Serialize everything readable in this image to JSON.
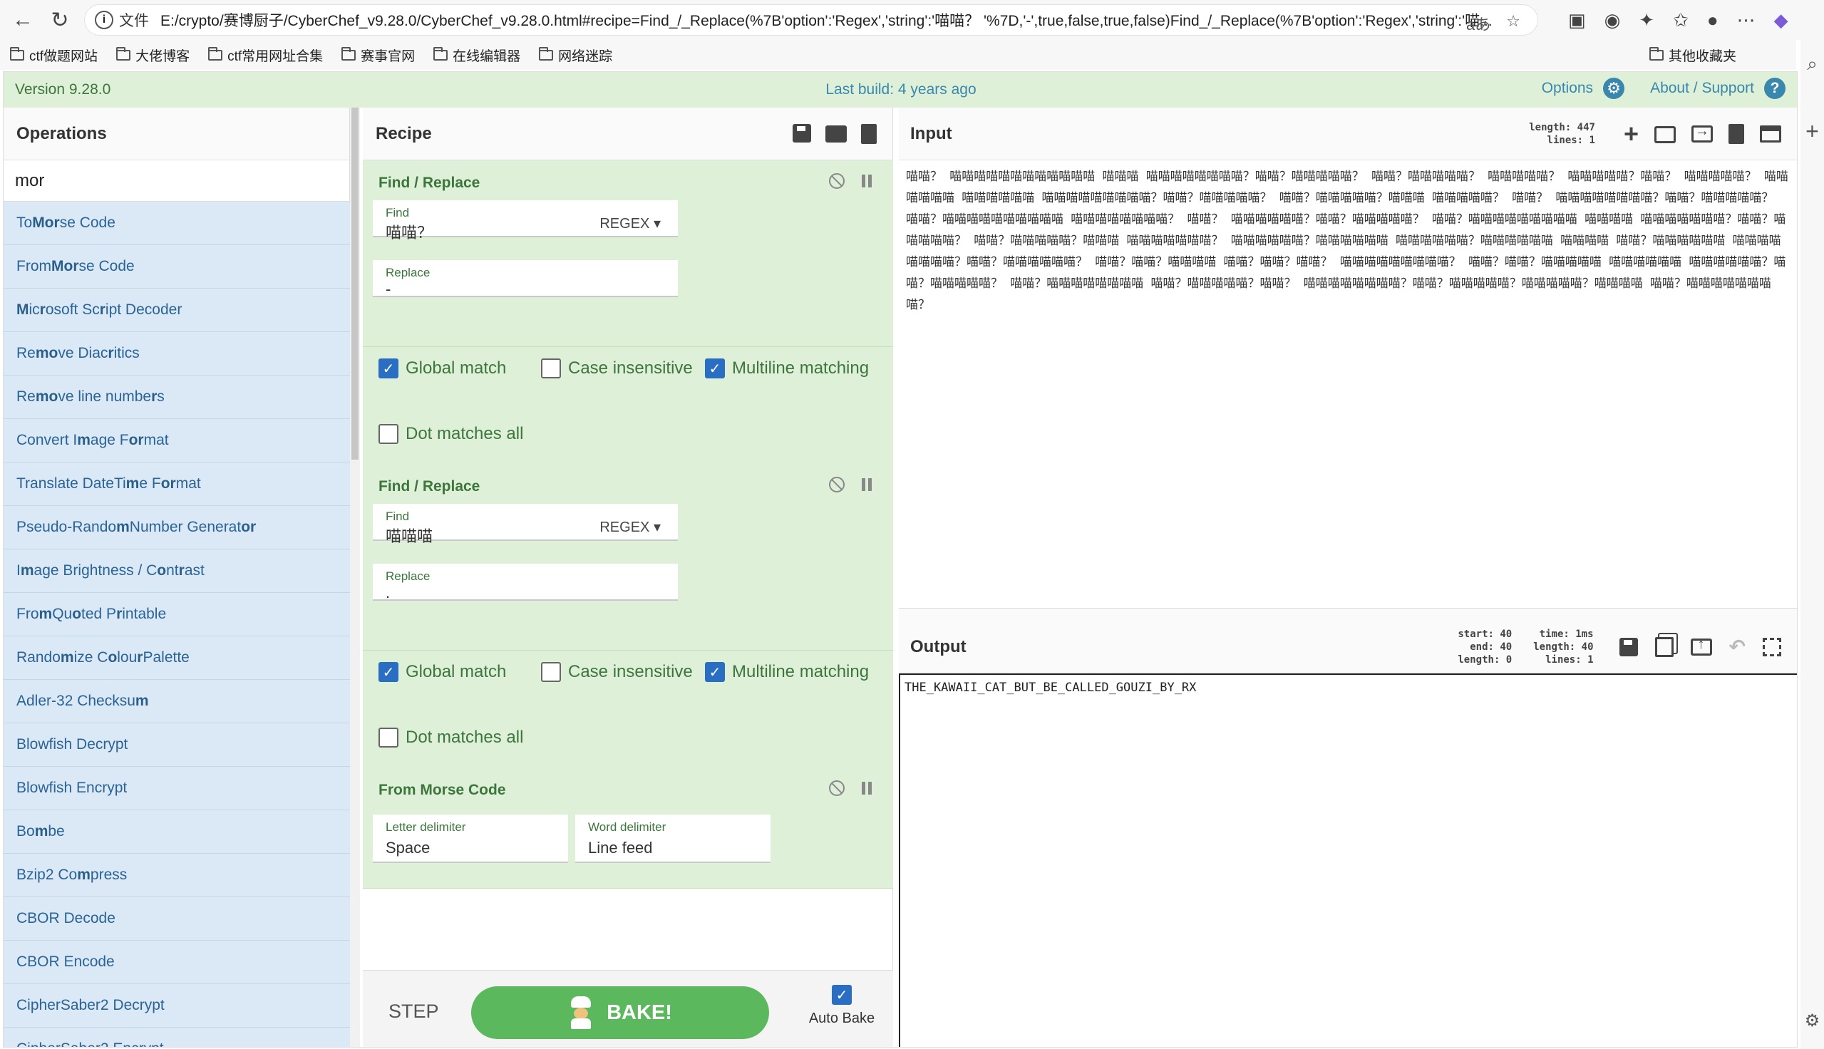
{
  "browser": {
    "url_scheme": "文件",
    "url": "E:/crypto/赛博厨子/CyberChef_v9.28.0/CyberChef_v9.28.0.html#recipe=Find_/_Replace(%7B'option':'Regex','string':'喵喵？ '%7D,'-',true,false,true,false)Find_/_Replace(%7B'option':'Regex','string':'喵...",
    "translate_icon": "aあ",
    "bookmarks": [
      "ctf做题网站",
      "大佬博客",
      "ctf常用网址合集",
      "赛事官网",
      "在线编辑器",
      "网络迷踪"
    ],
    "other_bookmarks": "其他收藏夹"
  },
  "banner": {
    "version": "Version 9.28.0",
    "last_build": "Last build: 4 years ago",
    "options": "Options",
    "about": "About / Support"
  },
  "operations": {
    "title": "Operations",
    "search_value": "mor",
    "items": [
      {
        "pre": "To ",
        "hl": "Mor",
        "post": "se Code"
      },
      {
        "pre": "From ",
        "hl": "Mor",
        "post": "se Code"
      },
      {
        "pre": "",
        "hl": "M",
        "post": "icrosoft Script Decoder",
        "html": "<b>M</b>ic<b>r</b>osoft Sc<b>r</b>ipt Decoder"
      },
      {
        "html": "Re<b>mo</b>ve Diac<b>r</b>itics"
      },
      {
        "html": "Re<b>mo</b>ve line numbe<b>r</b>s"
      },
      {
        "html": "Convert I<b>m</b>age F<b>or</b>mat"
      },
      {
        "html": "Translate DateTi<b>m</b>e F<b>or</b>mat"
      },
      {
        "html": "Pseudo-Rando<b>m</b> Number Generat<b>or</b>"
      },
      {
        "html": "I<b>m</b>age Brightness / C<b>o</b>nt<b>r</b>ast"
      },
      {
        "html": "Fro<b>m</b> Qu<b>o</b>ted P<b>r</b>intable"
      },
      {
        "html": "Rando<b>m</b>ize C<b>o</b>lou<b>r</b> Palette"
      },
      {
        "html": "Adler-32 Checksu<b>m</b>"
      },
      {
        "html": "Blowfish Decrypt"
      },
      {
        "html": "Blowfish Encrypt"
      },
      {
        "html": "Bo<b>m</b>be"
      },
      {
        "html": "Bzip2 Co<b>m</b>press"
      },
      {
        "html": "CBOR Decode"
      },
      {
        "html": "CBOR Encode"
      },
      {
        "html": "CipherSaber2 Decrypt"
      },
      {
        "html": "CipherSaber2 Encrypt"
      }
    ]
  },
  "recipe": {
    "title": "Recipe",
    "ingredients": [
      {
        "name": "Find / Replace",
        "find_label": "Find",
        "find_value": "喵喵？",
        "find_mode": "REGEX",
        "replace_label": "Replace",
        "replace_value": "-",
        "global_match": "Global match",
        "case_insensitive": "Case insensitive",
        "multiline": "Multiline matching",
        "dot_all": "Dot matches all"
      },
      {
        "name": "Find / Replace",
        "find_label": "Find",
        "find_value": "喵喵喵",
        "find_mode": "REGEX",
        "replace_label": "Replace",
        "replace_value": ".",
        "global_match": "Global match",
        "case_insensitive": "Case insensitive",
        "multiline": "Multiline matching",
        "dot_all": "Dot matches all"
      },
      {
        "name": "From Morse Code",
        "letter_label": "Letter delimiter",
        "letter_value": "Space",
        "word_label": "Word delimiter",
        "word_value": "Line feed"
      }
    ],
    "step_label": "STEP",
    "bake_label": "BAKE!",
    "auto_bake_label": "Auto Bake"
  },
  "input": {
    "title": "Input",
    "length_info": "length: 447",
    "lines_info": "lines:   1",
    "text": "喵喵？ 喵喵喵喵喵喵喵喵喵喵喵喵 喵喵喵 喵喵喵喵喵喵喵喵？喵喵？喵喵喵喵喵？ 喵喵？喵喵喵喵喵？ 喵喵喵喵喵？ 喵喵喵喵喵？喵喵？ 喵喵喵喵喵？ 喵喵喵喵喵喵 喵喵喵喵喵喵 喵喵喵喵喵喵喵喵喵？喵喵？喵喵喵喵喵？ 喵喵？喵喵喵喵喵？喵喵喵 喵喵喵喵喵？ 喵喵？ 喵喵喵喵喵喵喵喵？喵喵？喵喵喵喵喵？ 喵喵？喵喵喵喵喵喵喵喵喵喵 喵喵喵喵喵喵喵喵？ 喵喵？ 喵喵喵喵喵喵？喵喵？喵喵喵喵喵？ 喵喵？喵喵喵喵喵喵喵喵喵 喵喵喵喵 喵喵喵喵喵喵喵？喵喵？喵喵喵喵喵？ 喵喵？喵喵喵喵喵？喵喵喵 喵喵喵喵喵喵喵？ 喵喵喵喵喵喵？喵喵喵喵喵喵 喵喵喵喵喵喵？喵喵喵喵喵喵 喵喵喵喵 喵喵？喵喵喵喵喵喵 喵喵喵喵喵喵喵喵？喵喵？喵喵喵喵喵喵？ 喵喵？喵喵？喵喵喵喵 喵喵？喵喵？喵喵？ 喵喵喵喵喵喵喵喵喵？ 喵喵？喵喵？喵喵喵喵喵 喵喵喵喵喵喵 喵喵喵喵喵喵？喵喵？喵喵喵喵喵？ 喵喵？喵喵喵喵喵喵喵喵 喵喵？喵喵喵喵喵？喵喵？ 喵喵喵喵喵喵喵喵？喵喵？喵喵喵喵喵？喵喵喵喵喵？喵喵喵喵 喵喵？喵喵喵喵喵喵喵喵？"
  },
  "output": {
    "title": "Output",
    "start_info": "start: 40",
    "end_info": "end: 40",
    "sel_length_info": "length:  0",
    "time_info": "time:  1ms",
    "length_info": "length:  40",
    "lines_info": "lines:   1",
    "text": "THE_KAWAII_CAT_BUT_BE_CALLED_GOUZI_BY_RX"
  }
}
